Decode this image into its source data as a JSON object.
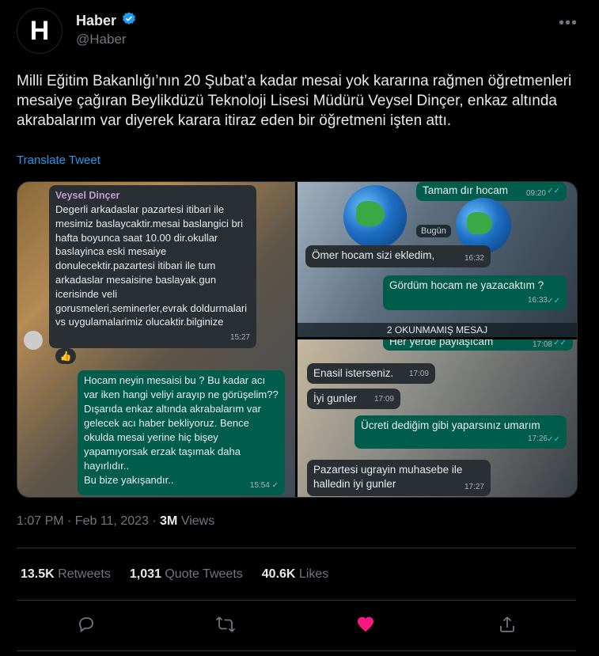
{
  "account": {
    "name": "Haber",
    "handle": "@Haber",
    "logo_letter": "H"
  },
  "tweet": {
    "text": "Milli Eğitim Bakanlığı’nın 20 Şubat’a kadar mesai yok kararına rağmen öğretmenleri mesaiye çağıran Beylikdüzü Teknoloji Lisesi Müdürü Veysel Dinçer, enkaz altında akrabalarım var diyerek karara itiraz eden bir öğretmeni işten attı.",
    "translate": "Translate Tweet"
  },
  "media": {
    "panel1": {
      "sender": "Veysel Dinçer",
      "msg1": "Degerli arkadaslar pazartesi itibari ile mesimiz baslaycaktir.mesai baslangici bri hafta boyunca saat 10.00 dir.okullar baslayinca eski mesaiye donulecektir.pazartesi itibari ile tum arkadaslar mesaisine baslayak.gun icerisinde veli gorusmeleri,seminerler,evrak doldurmalari vs uygulamalarimiz olucaktir.bilginize",
      "msg1_time": "15:27",
      "reaction": "👍",
      "msg2": "Hocam neyin mesaisi bu ? Bu  kadar acı var iken hangi veliyi arayıp ne görüşelim?? Dışarıda enkaz altında akrabalarım var gelecek acı haber bekliyoruz. Bence okulda mesai yerine hiç bişey yapamıyorsak erzak taşımak daha hayırlıdır..\nBu bize yakışandır..",
      "msg2_time": "15:54 ✓"
    },
    "panel2": {
      "top_msg": "Tamam dır hocam",
      "top_time": "09:20",
      "day": "Bugün",
      "msg1": "Ömer hocam sizi ekledim,",
      "msg1_time": "16:32",
      "msg2": "Gördüm hocam ne yazacaktım ?",
      "msg2_time": "16:33",
      "unread": "2 OKUNMAMIŞ MESAJ"
    },
    "panel3": {
      "top_msg": "Her yerde paylaşıcam",
      "top_time": "17:08",
      "msg1": "Enasil isterseniz.",
      "msg1_time": "17:09",
      "msg2": "İyi gunler",
      "msg2_time": "17:09",
      "msg3": "Ücreti dediğim gibi yaparsınız umarım",
      "msg3_time": "17:26",
      "msg4": "Pazartesi ugrayin muhasebe ile halledin iyi gunler",
      "msg4_time": "17:27"
    }
  },
  "meta": {
    "time": "1:07 PM · Feb 11, 2023 · ",
    "views_count": "3M",
    "views_label": " Views"
  },
  "stats": {
    "retweets_count": "13.5K",
    "retweets_label": " Retweets",
    "quotes_count": "1,031",
    "quotes_label": " Quote Tweets",
    "likes_count": "40.6K",
    "likes_label": " Likes"
  },
  "colors": {
    "accent": "#1d9bf0",
    "like": "#f91880",
    "muted": "#71767b"
  },
  "icons": [
    "verified-badge-icon",
    "more-icon",
    "reply-icon",
    "retweet-icon",
    "like-icon",
    "share-icon"
  ]
}
